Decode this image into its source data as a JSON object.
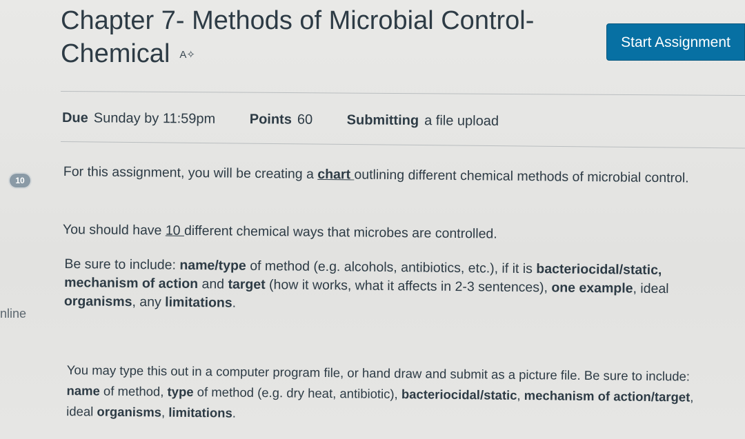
{
  "sidebar": {
    "badge_count": "10",
    "partial_label": "nline"
  },
  "header": {
    "title_line1": "Chapter 7- Methods of Microbial Control-",
    "title_line2": "Chemical",
    "translate_icon": "A✧",
    "start_button_label": "Start Assignment"
  },
  "meta": {
    "due_label": "Due",
    "due_value": "Sunday by 11:59pm",
    "points_label": "Points",
    "points_value": "60",
    "submitting_label": "Submitting",
    "submitting_value": "a file upload"
  },
  "body": {
    "p1_before": "For this assignment, you will be creating a ",
    "p1_link": "chart ",
    "p1_after": "outlining different chemical methods of microbial control.",
    "p2_before": "You should have ",
    "p2_underlined": "10 ",
    "p2_after": "different chemical ways that microbes are controlled.",
    "p3_a": "Be sure to include: ",
    "p3_b": "name/type",
    "p3_c": " of method (e.g. alcohols, antibiotics, etc.), if it is ",
    "p3_d": "bacteriocidal/static, mechanism of action",
    "p3_e": " and ",
    "p3_f": "target",
    "p3_g": " (how it works, what it affects in 2-3 sentences), ",
    "p3_h": "one example",
    "p3_i": ", ideal ",
    "p3_j": "organisms",
    "p3_k": ", any ",
    "p3_l": "limitations",
    "p3_m": ".",
    "p4_a": "You may type this out in a computer program file, or hand draw and submit as a picture file. Be sure to include: ",
    "p4_b": "name",
    "p4_c": " of method, ",
    "p4_d": "type",
    "p4_e": " of method (e.g. dry heat, antibiotic), ",
    "p4_f": "bacteriocidal/static",
    "p4_g": ", ",
    "p4_h": "mechanism of action/target",
    "p4_i": ", ideal ",
    "p4_j": "organisms",
    "p4_k": ", ",
    "p4_l": "limitations",
    "p4_m": "."
  }
}
